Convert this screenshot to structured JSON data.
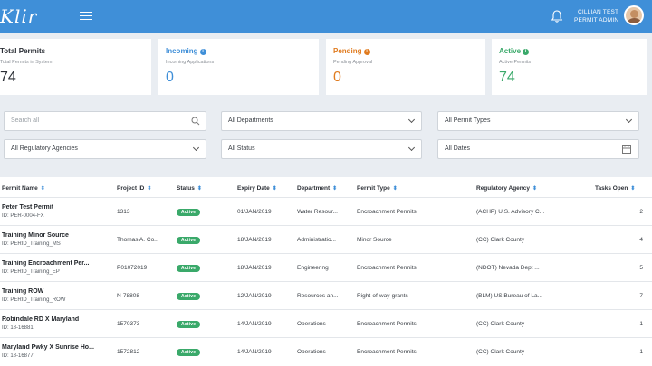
{
  "header": {
    "logo": "Klir",
    "user_name": "CILLIAN TEST",
    "user_role": "PERMIT ADMIN",
    "bar_color": "#3f8fd8"
  },
  "stats": [
    {
      "title": "Total Permits",
      "subtitle": "Total Permits in System",
      "value": "74",
      "color": "#2b2f36"
    },
    {
      "title": "Incoming",
      "subtitle": "Incoming Applications",
      "value": "0",
      "color": "#3f8fd8"
    },
    {
      "title": "Pending",
      "subtitle": "Pending Approval",
      "value": "0",
      "color": "#e07b1f"
    },
    {
      "title": "Active",
      "subtitle": "Active Permits",
      "value": "74",
      "color": "#3aa96a"
    }
  ],
  "filters": {
    "search_placeholder": "Search all",
    "departments": "All Departments",
    "permit_types": "All Permit Types",
    "agencies": "All Regulatory Agencies",
    "status": "All Status",
    "dates": "All Dates"
  },
  "table": {
    "columns": [
      "Permit Name",
      "Project ID",
      "Status",
      "Expiry Date",
      "Department",
      "Permit Type",
      "Regulatory Agency",
      "Tasks Open"
    ],
    "rows": [
      {
        "name": "Peter Test Permit",
        "id": "ID: PER-0004-FX",
        "project": "1313",
        "status": "Active",
        "expiry": "01/JAN/2019",
        "department": "Water Resour...",
        "type": "Encroachment Permits",
        "agency": "(ACHP) U.S. Advisory C...",
        "tasks": "2"
      },
      {
        "name": "Training Minor Source",
        "id": "ID: PERID_Training_MS",
        "project": "Thomas A. Co...",
        "status": "Active",
        "expiry": "18/JAN/2019",
        "department": "Administratio...",
        "type": "Minor Source",
        "agency": "(CC) Clark County",
        "tasks": "4"
      },
      {
        "name": "Training Encroachment Per...",
        "id": "ID: PERID_Training_EP",
        "project": "P01072019",
        "status": "Active",
        "expiry": "18/JAN/2019",
        "department": "Engineering",
        "type": "Encroachment Permits",
        "agency": "(NDOT) Nevada Dept ...",
        "tasks": "5"
      },
      {
        "name": "Training ROW",
        "id": "ID: PERID_Training_ROW",
        "project": "N-78808",
        "status": "Active",
        "expiry": "12/JAN/2019",
        "department": "Resources an...",
        "type": "Right-of-way-grants",
        "agency": "(BLM) US Bureau of La...",
        "tasks": "7"
      },
      {
        "name": "Robindale RD X Maryland",
        "id": "ID: 18-16881",
        "project": "1570373",
        "status": "Active",
        "expiry": "14/JAN/2019",
        "department": "Operations",
        "type": "Encroachment Permits",
        "agency": "(CC) Clark County",
        "tasks": "1"
      },
      {
        "name": "Maryland Pwky X Sunrise Ho...",
        "id": "ID: 18-16877",
        "project": "1572812",
        "status": "Active",
        "expiry": "14/JAN/2019",
        "department": "Operations",
        "type": "Encroachment Permits",
        "agency": "(CC) Clark County",
        "tasks": "1"
      }
    ]
  }
}
